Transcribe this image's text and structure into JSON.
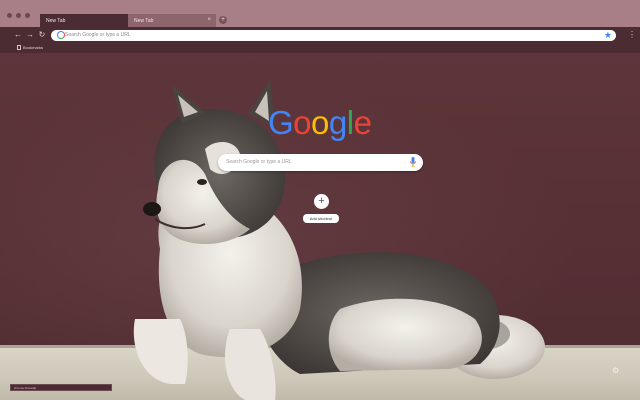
{
  "tabs": [
    {
      "label": "New Tab",
      "active": true
    },
    {
      "label": "New Tab",
      "active": false
    }
  ],
  "toolbar": {
    "omnibox_placeholder": "Search Google or type a URL"
  },
  "bookmarks": {
    "label": "Bookmarks"
  },
  "ntp": {
    "logo_letters": [
      "G",
      "o",
      "o",
      "g",
      "l",
      "e"
    ],
    "logo_colors": [
      "#4285f4",
      "#ea4335",
      "#fbbc05",
      "#4285f4",
      "#34a853",
      "#ea4335"
    ],
    "search_placeholder": "Search Google or type a URL",
    "shortcut_label": "Add shortcut",
    "shortcut_icon": "+"
  },
  "status": {
    "text": "chrome://newtab"
  },
  "colors": {
    "frame": "#a87f86",
    "toolbar": "#4b2c32",
    "background": "#5a3338"
  },
  "icons": {
    "back": "back-arrow-icon",
    "forward": "forward-arrow-icon",
    "reload": "reload-icon",
    "star": "star-icon",
    "menu": "menu-dots-icon",
    "mic": "mic-icon",
    "customize": "gear-icon"
  }
}
